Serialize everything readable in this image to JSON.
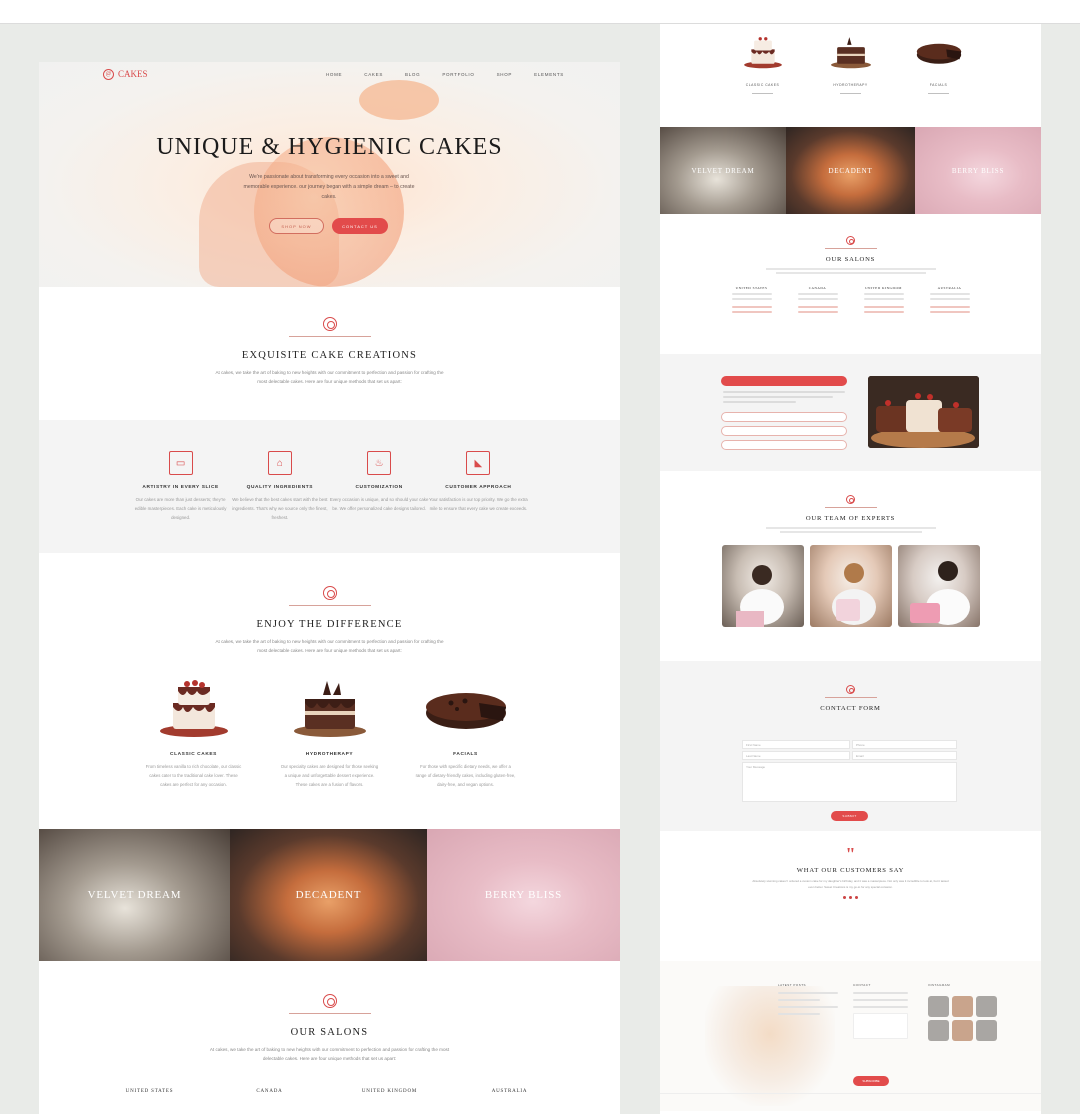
{
  "hero": {
    "logo": "CAKES",
    "nav": [
      "HOME",
      "CAKES",
      "BLOG",
      "PORTFOLIO",
      "SHOP",
      "ELEMENTS"
    ],
    "title": "UNIQUE & HYGIENIC CAKES",
    "text": "We're passionate about transforming every occasion into a sweet and memorable experience. our journey began with a simple dream – to create cakes.",
    "btn_shop": "SHOP NOW",
    "btn_contact": "CONTACT US"
  },
  "creations": {
    "title": "EXQUISITE CAKE CREATIONS",
    "text": "At cakes, we take the art of baking to new heights with our commitment to perfection and passion for crafting the most delectable cakes. Here are four unique methods that set us apart:"
  },
  "features": [
    {
      "title": "ARTISTRY IN EVERY SLICE",
      "text": "Our cakes are more than just desserts; they're edible masterpieces. Each cake is meticulously designed."
    },
    {
      "title": "QUALITY INGREDIENTS",
      "text": "We believe that the best cakes start with the best ingredients. That's why we source only the finest, freshest."
    },
    {
      "title": "CUSTOMIZATION",
      "text": "Every occasion is unique, and so should your cake be. We offer personalized cake designs tailored."
    },
    {
      "title": "CUSTOMER APPROACH",
      "text": "Your satisfaction is our top priority. We go the extra mile to ensure that every cake we create exceeds."
    }
  ],
  "enjoy": {
    "title": "ENJOY THE DIFFERENCE",
    "text": "At cakes, we take the art of baking to new heights with our commitment to perfection and passion for crafting the most delectable cakes. Here are four unique methods that set us apart:",
    "cakes": [
      {
        "name": "CLASSIC CAKES",
        "text": "From timeless vanilla to rich chocolate, our classic cakes cater to the traditional cake lover. These cakes are perfect for any occasion."
      },
      {
        "name": "HYDROTHERAPY",
        "text": "Our specialty cakes are designed for those seeking a unique and unforgettable dessert experience. These cakes are a fusion of flavors."
      },
      {
        "name": "FACIALS",
        "text": "For those with specific dietary needs, we offer a range of dietary-friendly cakes, including gluten-free, dairy-free, and vegan options."
      }
    ]
  },
  "banners": [
    "VELVET DREAM",
    "DECADENT",
    "BERRY BLISS"
  ],
  "salons": {
    "title": "OUR SALONS",
    "text": "At cakes, we take the art of baking to new heights with our commitment to perfection and passion for crafting the most delectable cakes. Here are four unique methods that set us apart:",
    "countries": [
      "UNITED STATES",
      "CANADA",
      "UNITED KINGDOM",
      "AUSTRALIA"
    ]
  },
  "right": {
    "cakes": [
      "CLASSIC CAKES",
      "HYDROTHERAPY",
      "FACIALS"
    ],
    "banners": [
      "VELVET DREAM",
      "DECADENT",
      "BERRY BLISS"
    ],
    "salons_title": "OUR SALONS",
    "countries": [
      "UNITED STATES",
      "CANADA",
      "UNITED KINGDOM",
      "AUSTRALIA"
    ],
    "team_title": "OUR TEAM OF EXPERTS",
    "team": [
      "",
      "",
      ""
    ],
    "contact_title": "CONTACT FORM",
    "contact_fields": [
      "First Name",
      "Phone",
      "Last Name",
      "Email",
      "Your Message"
    ],
    "contact_btn": "SUBMIT",
    "testimonial_title": "WHAT OUR CUSTOMERS SAY",
    "testimonial_text": "Absolutely stunning cakes! I ordered a custom cake for my daughter's birthday, and it was a masterpiece. Not only was it incredible to look at, but it tasted even better. Sweet Creations is my go-to for any special occasion.",
    "footer_cols": [
      "LATEST POSTS",
      "CONTACT",
      "INSTAGRAM"
    ],
    "footer_btn": "SUBSCRIBE"
  },
  "colors": {
    "accent": "#e24b4b",
    "muted": "#f4f4f4"
  }
}
